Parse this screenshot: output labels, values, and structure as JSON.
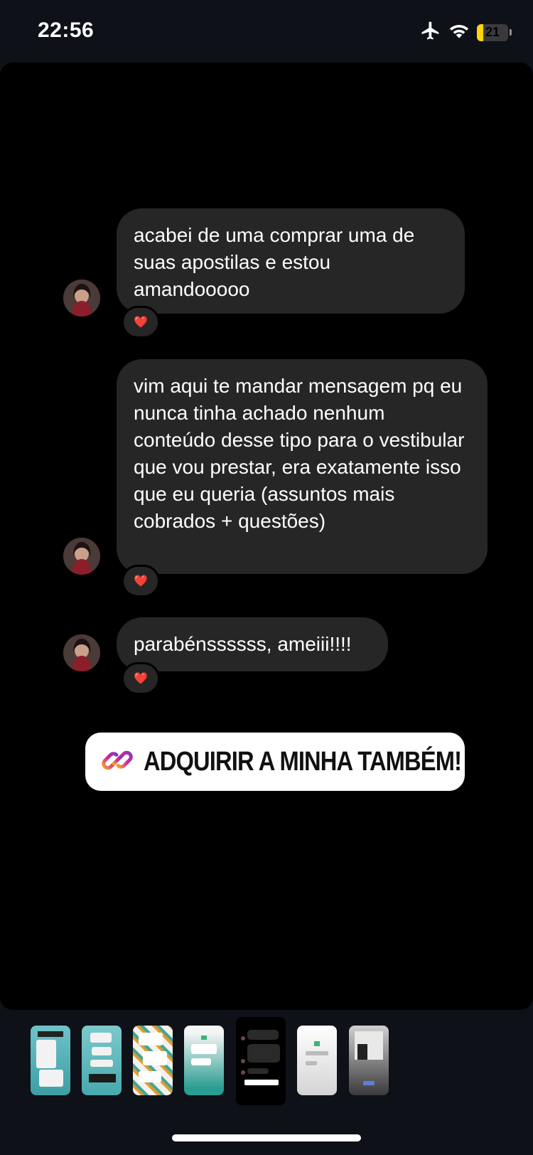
{
  "status_bar": {
    "time": "22:56",
    "battery_level": "21",
    "battery_fraction": 0.21
  },
  "messages": [
    {
      "text": "acabei de uma comprar uma de suas apostilas e estou amandooooo",
      "reaction": "❤️"
    },
    {
      "text": "vim aqui te mandar mensagem pq eu nunca tinha achado nenhum conteúdo desse tipo para o vestibular que vou prestar, era exatamente isso que eu queria (assuntos mais cobrados + questões)",
      "reaction": "❤️"
    },
    {
      "text": "parabénssssss, ameiii!!!!",
      "reaction": "❤️"
    }
  ],
  "link_sticker": {
    "label": "ADQUIRIR A MINHA TAMBÉM!"
  },
  "thumbnails": {
    "count": 7,
    "selected_index": 4
  },
  "colors": {
    "bubble": "#262626",
    "background": "#000000",
    "status_bar_bg": "#0e1117",
    "accent_gradient": [
      "#f5a623",
      "#d6249f",
      "#833ab4"
    ]
  }
}
